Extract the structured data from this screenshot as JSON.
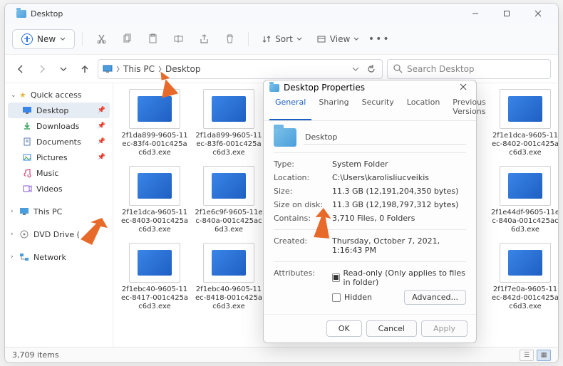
{
  "window": {
    "title": "Desktop"
  },
  "toolbar": {
    "new_label": "New",
    "sort_label": "Sort",
    "view_label": "View"
  },
  "breadcrumbs": [
    "This PC",
    "Desktop"
  ],
  "search": {
    "placeholder": "Search Desktop"
  },
  "sidebar": {
    "quick_access": "Quick access",
    "items": [
      {
        "label": "Desktop",
        "icon": "desktop"
      },
      {
        "label": "Downloads",
        "icon": "downloads"
      },
      {
        "label": "Documents",
        "icon": "documents"
      },
      {
        "label": "Pictures",
        "icon": "pictures"
      },
      {
        "label": "Music",
        "icon": "music"
      },
      {
        "label": "Videos",
        "icon": "videos"
      }
    ],
    "this_pc": "This PC",
    "dvd": "DVD Drive (",
    "network": "Network"
  },
  "files": [
    "2f1da899-9605-11ec-83f4-001c425ac6d3.exe",
    "2f1da899-9605-11ec-83f6-001c425ac6d3.exe",
    "",
    "",
    "",
    "2f1e1dca-9605-11ec-8402-001c425ac6d3.exe",
    "2f1e1dca-9605-11ec-8403-001c425ac6d3.exe",
    "2f1e6c9f-9605-11ec-840a-001c425ac6d3.exe",
    "",
    "",
    "",
    "2f1e44df-9605-11ec-840a-001c425ac6d3.exe",
    "2f1ebc40-9605-11ec-8417-001c425ac6d3.exe",
    "2f1ebc40-9605-11ec-8418-001c425ac6d3.exe",
    "",
    "",
    "",
    "2f1f7e0a-9605-11ec-842d-001c425ac6d3.exe"
  ],
  "status": {
    "count": "3,709 items"
  },
  "properties": {
    "title": "Desktop Properties",
    "tabs": [
      "General",
      "Sharing",
      "Security",
      "Location",
      "Previous Versions"
    ],
    "name": "Desktop",
    "type_label": "Type:",
    "type": "System Folder",
    "location_label": "Location:",
    "location": "C:\\Users\\karolisliucveikis",
    "size_label": "Size:",
    "size": "11.3 GB (12,191,204,350 bytes)",
    "sizeod_label": "Size on disk:",
    "sizeod": "11.3 GB (12,198,797,312 bytes)",
    "contains_label": "Contains:",
    "contains": "3,710 Files, 0 Folders",
    "created_label": "Created:",
    "created": "Thursday, October 7, 2021, 1:16:43 PM",
    "attributes_label": "Attributes:",
    "readonly_label": "Read-only (Only applies to files in folder)",
    "hidden_label": "Hidden",
    "advanced_label": "Advanced...",
    "ok": "OK",
    "cancel": "Cancel",
    "apply": "Apply"
  },
  "colors": {
    "accent": "#1a5fc4",
    "arrow": "#e86a2a"
  }
}
